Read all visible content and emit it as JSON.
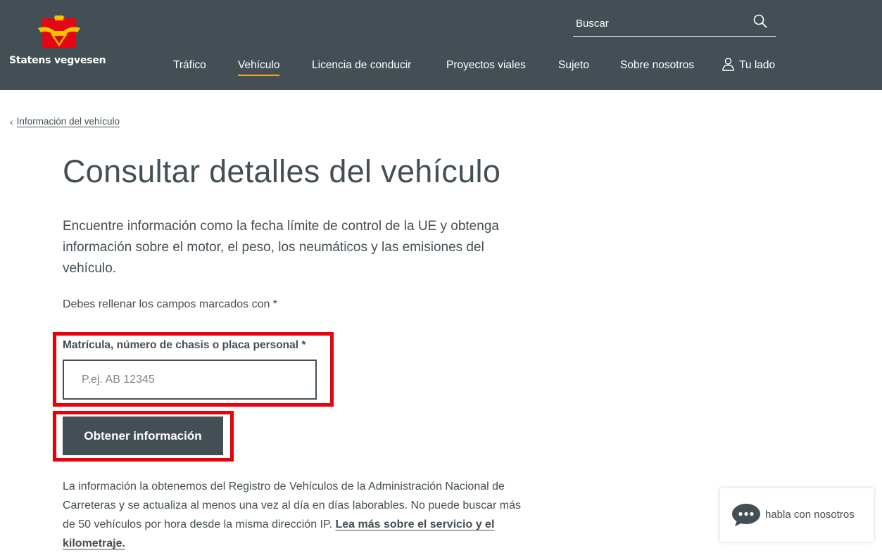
{
  "header": {
    "logo_text": "Statens vegvesen",
    "search_placeholder": "Buscar",
    "nav": [
      {
        "label": "Tráfico"
      },
      {
        "label": "Vehículo",
        "active": true
      },
      {
        "label": "Licencia de conducir"
      },
      {
        "label": "Proyectos viales"
      },
      {
        "label": "Sujeto"
      },
      {
        "label": "Sobre nosotros"
      },
      {
        "label": "Tu lado",
        "icon": "user-icon"
      }
    ]
  },
  "breadcrumb": {
    "back_label": "Información del vehículo",
    "icon": "chevron-left-icon"
  },
  "main": {
    "title": "Consultar detalles del vehículo",
    "intro": "Encuentre información como la fecha límite de control de la UE y obtenga información sobre el motor, el peso, los neumáticos y las emisiones del vehículo.",
    "required_note": "Debes rellenar los campos marcados con *",
    "field_label": "Matrícula, número de chasis o placa personal *",
    "field_placeholder": "P.ej. AB 12345",
    "field_value": "",
    "button_label": "Obtener información",
    "footer_text": "La información la obtenemos del Registro de Vehículos de la Administración Nacional de Carreteras y se actualiza al menos una vez al día en días laborables.  No puede buscar más de 50 vehículos por hora desde la misma dirección IP. ",
    "footer_link": "Lea más sobre el servicio y el kilometraje."
  },
  "chat": {
    "label": "habla con nosotros",
    "icon": "chat-bubble-icon"
  },
  "colors": {
    "header_bg": "#444f55",
    "text": "#444f55",
    "active_underline": "#f5a623",
    "highlight": "#e8000b",
    "logo_red": "#e30613",
    "logo_yellow": "#f7c400"
  }
}
